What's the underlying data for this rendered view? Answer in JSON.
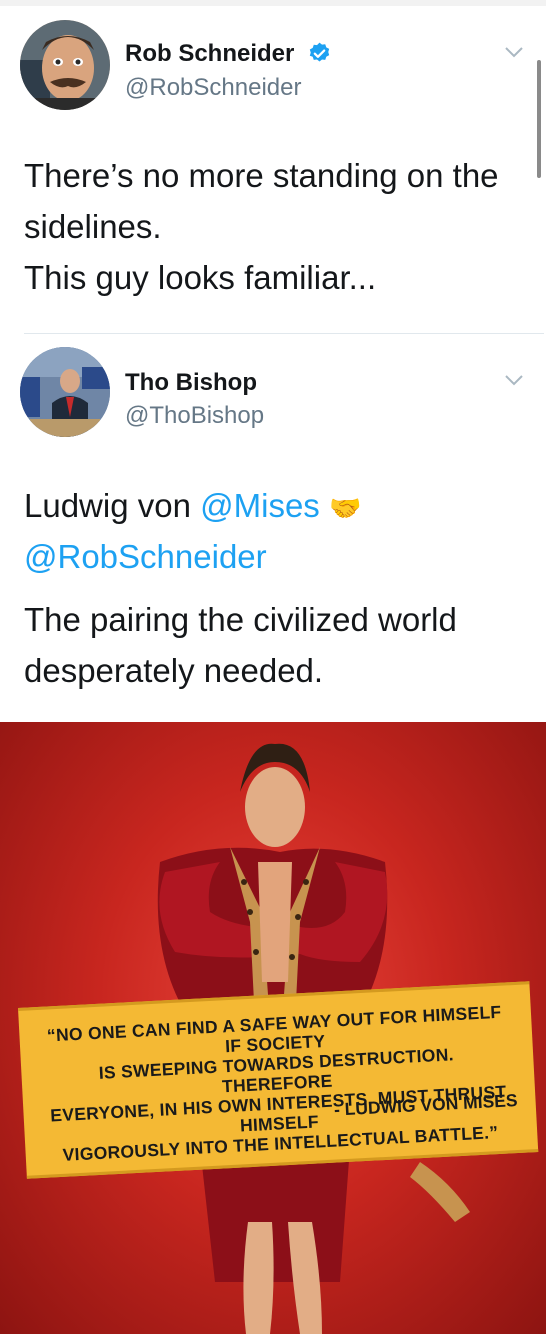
{
  "tweets": [
    {
      "name": "Rob Schneider",
      "handle": "@RobSchneider",
      "verified": true,
      "text_lines": [
        "There’s no more standing on the",
        "sidelines.",
        "This guy looks familiar..."
      ]
    },
    {
      "name": "Tho Bishop",
      "handle": "@ThoBishop",
      "text_parts": {
        "line1_prefix": "Ludwig von ",
        "line1_link": "@Mises",
        "line1_emoji": "🤝",
        "line2_link": "@RobSchneider",
        "line3": "The pairing the civilized world",
        "line4": "desperately needed."
      }
    }
  ],
  "image": {
    "quote_lines": [
      "“NO ONE CAN FIND A SAFE WAY OUT FOR HIMSELF IF SOCIETY",
      "IS SWEEPING TOWARDS DESTRUCTION. THEREFORE",
      "EVERYONE, IN HIS OWN INTERESTS, MUST THRUST HIMSELF",
      "VIGOROUSLY INTO THE INTELLECTUAL BATTLE.”"
    ],
    "attribution": "- LUDWIG VON MISES"
  },
  "colors": {
    "link": "#1da1f2",
    "verified": "#1da1f2",
    "banner": "#f4b934",
    "poster_red": "#c8261f"
  },
  "icons": {
    "verified": "verified-badge-icon",
    "chevron": "chevron-down-icon",
    "handshake": "handshake-emoji"
  }
}
